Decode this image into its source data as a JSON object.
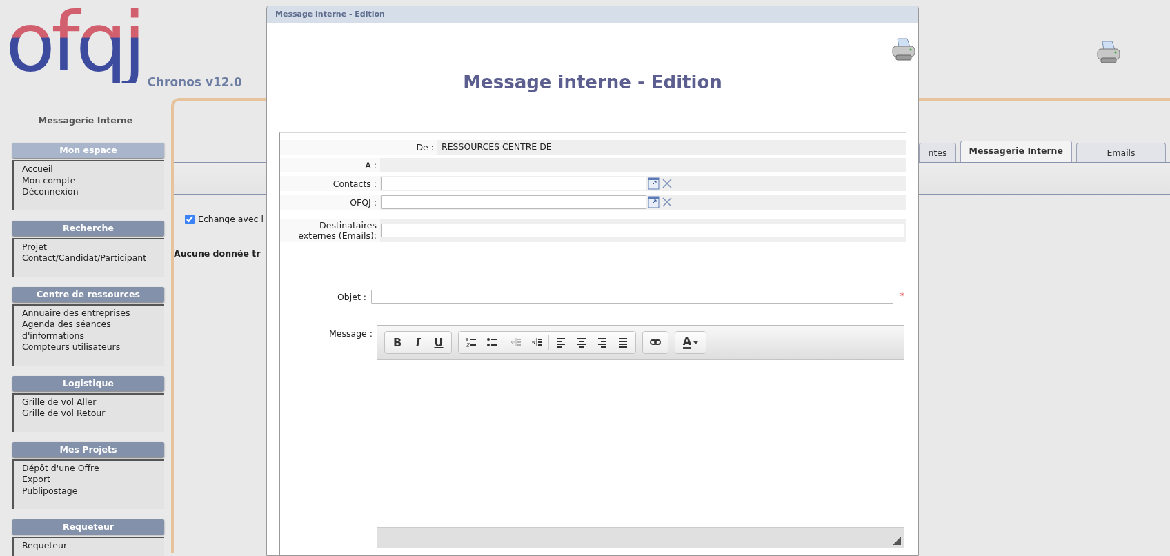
{
  "logo": {
    "mark": "ofqj",
    "product": "Chronos v12.0"
  },
  "sidebar": {
    "title": "Messagerie Interne",
    "sections": [
      {
        "title": "Mon espace",
        "selected": true,
        "items": [
          "Accueil",
          "Mon compte",
          "Déconnexion"
        ]
      },
      {
        "title": "Recherche",
        "selected": false,
        "items": [
          "Projet",
          "Contact/Candidat/Participant"
        ]
      },
      {
        "title": "Centre de ressources",
        "selected": false,
        "items": [
          "Annuaire des entreprises",
          "Agenda des séances d'informations",
          "Compteurs utilisateurs"
        ]
      },
      {
        "title": "Logistique",
        "selected": false,
        "items": [
          "Grille de vol Aller",
          "Grille de vol Retour"
        ]
      },
      {
        "title": "Mes Projets",
        "selected": false,
        "items": [
          "Dépôt d'une Offre",
          "Export",
          "Publipostage"
        ]
      },
      {
        "title": "Requeteur",
        "selected": false,
        "items": [
          "Requeteur"
        ]
      }
    ]
  },
  "page": {
    "tabs": [
      {
        "label": "ntes",
        "selected": false
      },
      {
        "label": "Messagerie Interne",
        "selected": true
      },
      {
        "label": "Emails",
        "selected": false
      }
    ],
    "filter": {
      "label": "Echange avec l",
      "checked": true
    },
    "empty_message": "Aucune donnée tr"
  },
  "modal": {
    "title": "Message interne - Edition",
    "heading": "Message interne - Edition",
    "fields": [
      {
        "kind": "sender",
        "label": "De :",
        "value": "RESSOURCES CENTRE DE"
      },
      {
        "kind": "readonly",
        "label": "A :"
      },
      {
        "kind": "picker",
        "label": "Contacts :"
      },
      {
        "kind": "picker",
        "label": "OFQJ :"
      },
      {
        "kind": "text",
        "label": "Destinataires externes (Emails):"
      },
      {
        "kind": "subject",
        "label": "Objet :",
        "required_mark": "*"
      }
    ],
    "message": {
      "label": "Message :",
      "toolbar": [
        {
          "sections": [
            [
              {
                "kind": "bold",
                "label": "B",
                "disabled": false
              },
              {
                "kind": "italic",
                "label": "I",
                "disabled": false
              },
              {
                "kind": "underline",
                "label": "U",
                "disabled": false
              }
            ]
          ]
        },
        {
          "sections": [
            [
              {
                "kind": "ol",
                "disabled": false
              },
              {
                "kind": "ul",
                "disabled": false
              }
            ],
            [
              {
                "kind": "outdent",
                "disabled": true
              },
              {
                "kind": "indent",
                "disabled": false
              }
            ],
            [
              {
                "kind": "left",
                "disabled": false
              },
              {
                "kind": "center",
                "disabled": false
              },
              {
                "kind": "right",
                "disabled": false
              },
              {
                "kind": "justify",
                "disabled": false
              }
            ]
          ]
        },
        {
          "sections": [
            [
              {
                "kind": "link",
                "disabled": false
              }
            ]
          ]
        },
        {
          "sections": [
            [
              {
                "kind": "color",
                "label": "A",
                "disabled": false
              }
            ]
          ]
        }
      ]
    }
  }
}
